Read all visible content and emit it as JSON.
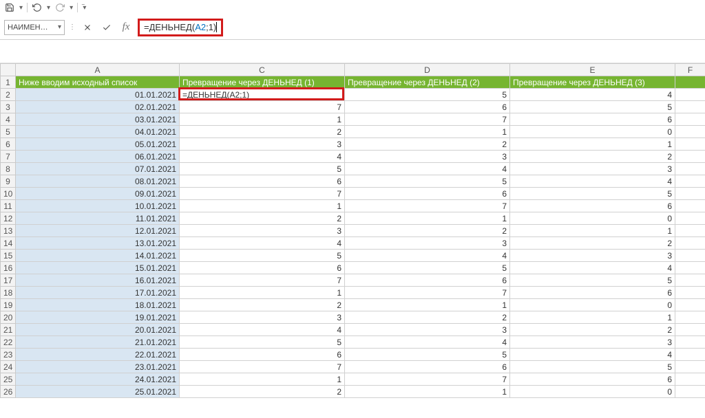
{
  "qat": {
    "save": "save",
    "undo": "undo",
    "redo": "redo",
    "custom": "customize"
  },
  "nameBox": "НАИМЕН…",
  "formula": {
    "prefix": "=ДЕНЬНЕД(",
    "ref": "A2",
    "suffix": ";1)"
  },
  "formulaPlain": "=ДЕНЬНЕД(A2;1)",
  "columns": [
    "A",
    "C",
    "D",
    "E",
    "F"
  ],
  "headerRow": {
    "A": "Ниже вводим исходный список",
    "C": "Превращение через ДЕНЬНЕД (1)",
    "D": "Превращение через ДЕНЬНЕД (2)",
    "E": "Превращение через ДЕНЬНЕД (3)"
  },
  "editingText": "=ДЕНЬНЕД(A2;1)",
  "chart_data": {
    "type": "table",
    "columns": [
      "row",
      "A",
      "C",
      "D",
      "E"
    ],
    "rows": [
      {
        "row": 2,
        "A": "01.01.2021",
        "C": "=ДЕНЬНЕД(A2;1)",
        "D": 5,
        "E": 4
      },
      {
        "row": 3,
        "A": "02.01.2021",
        "C": 7,
        "D": 6,
        "E": 5
      },
      {
        "row": 4,
        "A": "03.01.2021",
        "C": 1,
        "D": 7,
        "E": 6
      },
      {
        "row": 5,
        "A": "04.01.2021",
        "C": 2,
        "D": 1,
        "E": 0
      },
      {
        "row": 6,
        "A": "05.01.2021",
        "C": 3,
        "D": 2,
        "E": 1
      },
      {
        "row": 7,
        "A": "06.01.2021",
        "C": 4,
        "D": 3,
        "E": 2
      },
      {
        "row": 8,
        "A": "07.01.2021",
        "C": 5,
        "D": 4,
        "E": 3
      },
      {
        "row": 9,
        "A": "08.01.2021",
        "C": 6,
        "D": 5,
        "E": 4
      },
      {
        "row": 10,
        "A": "09.01.2021",
        "C": 7,
        "D": 6,
        "E": 5
      },
      {
        "row": 11,
        "A": "10.01.2021",
        "C": 1,
        "D": 7,
        "E": 6
      },
      {
        "row": 12,
        "A": "11.01.2021",
        "C": 2,
        "D": 1,
        "E": 0
      },
      {
        "row": 13,
        "A": "12.01.2021",
        "C": 3,
        "D": 2,
        "E": 1
      },
      {
        "row": 14,
        "A": "13.01.2021",
        "C": 4,
        "D": 3,
        "E": 2
      },
      {
        "row": 15,
        "A": "14.01.2021",
        "C": 5,
        "D": 4,
        "E": 3
      },
      {
        "row": 16,
        "A": "15.01.2021",
        "C": 6,
        "D": 5,
        "E": 4
      },
      {
        "row": 17,
        "A": "16.01.2021",
        "C": 7,
        "D": 6,
        "E": 5
      },
      {
        "row": 18,
        "A": "17.01.2021",
        "C": 1,
        "D": 7,
        "E": 6
      },
      {
        "row": 19,
        "A": "18.01.2021",
        "C": 2,
        "D": 1,
        "E": 0
      },
      {
        "row": 20,
        "A": "19.01.2021",
        "C": 3,
        "D": 2,
        "E": 1
      },
      {
        "row": 21,
        "A": "20.01.2021",
        "C": 4,
        "D": 3,
        "E": 2
      },
      {
        "row": 22,
        "A": "21.01.2021",
        "C": 5,
        "D": 4,
        "E": 3
      },
      {
        "row": 23,
        "A": "22.01.2021",
        "C": 6,
        "D": 5,
        "E": 4
      },
      {
        "row": 24,
        "A": "23.01.2021",
        "C": 7,
        "D": 6,
        "E": 5
      },
      {
        "row": 25,
        "A": "24.01.2021",
        "C": 1,
        "D": 7,
        "E": 6
      },
      {
        "row": 26,
        "A": "25.01.2021",
        "C": 2,
        "D": 1,
        "E": 0
      }
    ]
  }
}
